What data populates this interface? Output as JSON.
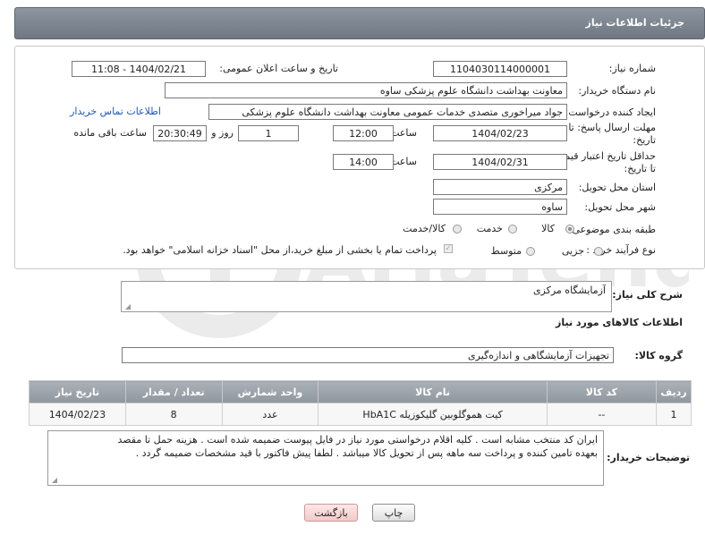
{
  "header": {
    "title": "جزئیات اطلاعات نیاز"
  },
  "fields": {
    "need_number_label": "شماره نیاز:",
    "need_number": "1104030114000001",
    "announce_label": "تاریخ و ساعت اعلان عمومی:",
    "announce_value": "1404/02/21 - 11:08",
    "buyer_org_label": "نام دستگاه خریدار:",
    "buyer_org": "معاونت بهداشت دانشگاه علوم پزشکی ساوه",
    "requester_label": "ایجاد کننده درخواست:",
    "requester": "جواد میراخوری متصدی خدمات عمومی معاونت بهداشت دانشگاه علوم پزشکی",
    "contact_link": "اطلاعات تماس خریدار",
    "deadline_label_1": "مهلت ارسال پاسخ: تا",
    "deadline_label_2": "تاریخ:",
    "deadline_date": "1404/02/23",
    "time_label": "ساعت",
    "deadline_time": "12:00",
    "days_value": "1",
    "days_label": "روز و",
    "remaining_time": "20:30:49",
    "remaining_label": "ساعت باقی مانده",
    "price_label_1": "حداقل تاریخ اعتبار قیمت:",
    "price_label_2": "تا تاریخ:",
    "price_date": "1404/02/31",
    "price_time": "14:00",
    "province_label": "استان محل تحویل:",
    "province": "مرکزی",
    "city_label": "شهر محل تحویل:",
    "city": "ساوه",
    "category_label": "طبقه بندی موضوعی:",
    "category_options": [
      "کالا",
      "خدمت",
      "کالا/خدمت"
    ],
    "process_label": "نوع فرآیند خرید :",
    "process_options": [
      "جزیی",
      "متوسط"
    ],
    "payment_note": "پرداخت تمام یا بخشی از مبلغ خرید،از محل \"اسناد خزانه اسلامی\" خواهد بود."
  },
  "description": {
    "label": "شرح کلی نیاز:",
    "value": "آزمایشگاه مرکزی"
  },
  "goods": {
    "section_title": "اطلاعات کالاهای مورد نیاز",
    "group_label": "گروه کالا:",
    "group_value": "تجهیزات آزمایشگاهی و اندازه‌گیری",
    "columns": [
      "ردیف",
      "کد کالا",
      "نام کالا",
      "واحد شمارش",
      "تعداد / مقدار",
      "تاریخ نیاز"
    ],
    "rows": [
      {
        "row": "1",
        "code": "--",
        "name": "کیت هموگلوبین گلیکوزیله HbA1C",
        "unit": "عدد",
        "qty": "8",
        "date": "1404/02/23"
      }
    ]
  },
  "notes": {
    "label": "توضیحات خریدار:",
    "lines": [
      "ایران کد منتخب مشابه است . کلیه اقلام درخواستی مورد نیاز در فایل پیوست ضمیمه شده است . هزینه حمل تا مقصد",
      "بعهده تامین کننده و پرداخت سه ماهه پس از تحویل کالا میباشد . لطفا پیش فاکتور با قید مشخصات ضمیمه گردد ."
    ]
  },
  "buttons": {
    "print": "چاپ",
    "back": "بازگشت"
  },
  "watermark": {
    "text": "AriaTender.net"
  },
  "colors": {
    "header_bg": "#7f8892",
    "link": "#1a56c9",
    "back_btn_bg": "#fbdcdc"
  }
}
